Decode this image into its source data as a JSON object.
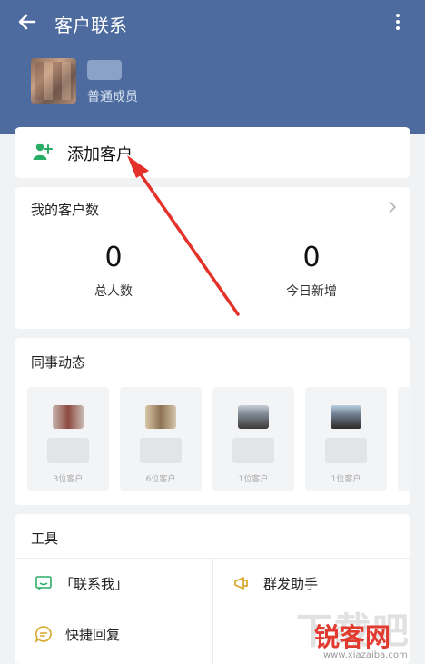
{
  "header": {
    "title": "客户联系",
    "member_role": "普通成员"
  },
  "add_customer": {
    "label": "添加客户"
  },
  "customer_count": {
    "title": "我的客户数",
    "total": {
      "value": "0",
      "label": "总人数"
    },
    "today": {
      "value": "0",
      "label": "今日新增"
    }
  },
  "colleague_feed": {
    "title": "同事动态",
    "items": [
      {
        "count_text": "3位客户"
      },
      {
        "count_text": "6位客户"
      },
      {
        "count_text": "1位客户"
      },
      {
        "count_text": "1位客户"
      }
    ]
  },
  "tools": {
    "title": "工具",
    "items": [
      {
        "label": "「联系我」",
        "icon": "contact-me-icon"
      },
      {
        "label": "群发助手",
        "icon": "megaphone-icon"
      },
      {
        "label": "快捷回复",
        "icon": "quick-reply-icon"
      }
    ]
  },
  "watermark": {
    "brand": "下载吧",
    "site": "锐客网",
    "url": "www.xiazaiba.com"
  },
  "colors": {
    "header": "#4d6b9e",
    "accent_green": "#2aae67",
    "icon_yellow": "#d7a72a",
    "arrow_red": "#e4322b"
  }
}
